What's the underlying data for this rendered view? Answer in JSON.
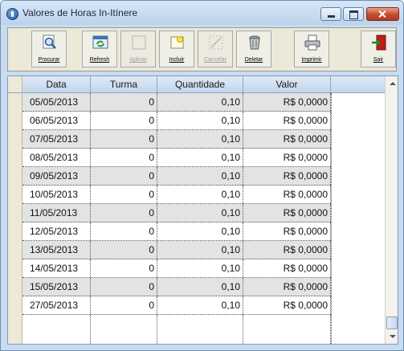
{
  "window": {
    "title": "Valores de Horas In-Itínere"
  },
  "toolbar": {
    "buttons": [
      {
        "label": "Procurar",
        "enabled": true,
        "icon": "search-icon"
      },
      {
        "label": "Refresh",
        "enabled": true,
        "icon": "refresh-icon"
      },
      {
        "label": "Aplicar",
        "enabled": false,
        "icon": "apply-icon"
      },
      {
        "label": "Incluir",
        "enabled": true,
        "icon": "new-record-icon"
      },
      {
        "label": "Cancelar",
        "enabled": false,
        "icon": "cancel-icon"
      },
      {
        "label": "Deletar",
        "enabled": true,
        "icon": "trash-icon"
      },
      {
        "label": "Imprimir",
        "enabled": true,
        "icon": "printer-icon"
      },
      {
        "label": "Sair",
        "enabled": true,
        "icon": "exit-door-icon"
      }
    ]
  },
  "grid": {
    "columns": [
      "Data",
      "Turma",
      "Quantidade",
      "Valor"
    ],
    "rows": [
      [
        "05/05/2013",
        "0",
        "0,10",
        "R$ 0,0000"
      ],
      [
        "06/05/2013",
        "0",
        "0,10",
        "R$ 0,0000"
      ],
      [
        "07/05/2013",
        "0",
        "0,10",
        "R$ 0,0000"
      ],
      [
        "08/05/2013",
        "0",
        "0,10",
        "R$ 0,0000"
      ],
      [
        "09/05/2013",
        "0",
        "0,10",
        "R$ 0,0000"
      ],
      [
        "10/05/2013",
        "0",
        "0,10",
        "R$ 0,0000"
      ],
      [
        "11/05/2013",
        "0",
        "0,10",
        "R$ 0,0000"
      ],
      [
        "12/05/2013",
        "0",
        "0,10",
        "R$ 0,0000"
      ],
      [
        "13/05/2013",
        "0",
        "0,10",
        "R$ 0,0000"
      ],
      [
        "14/05/2013",
        "0",
        "0,10",
        "R$ 0,0000"
      ],
      [
        "15/05/2013",
        "0",
        "0,10",
        "R$ 0,0000"
      ],
      [
        "27/05/2013",
        "0",
        "0,10",
        "R$ 0,0000"
      ],
      [
        "",
        "",
        "",
        ""
      ]
    ]
  }
}
